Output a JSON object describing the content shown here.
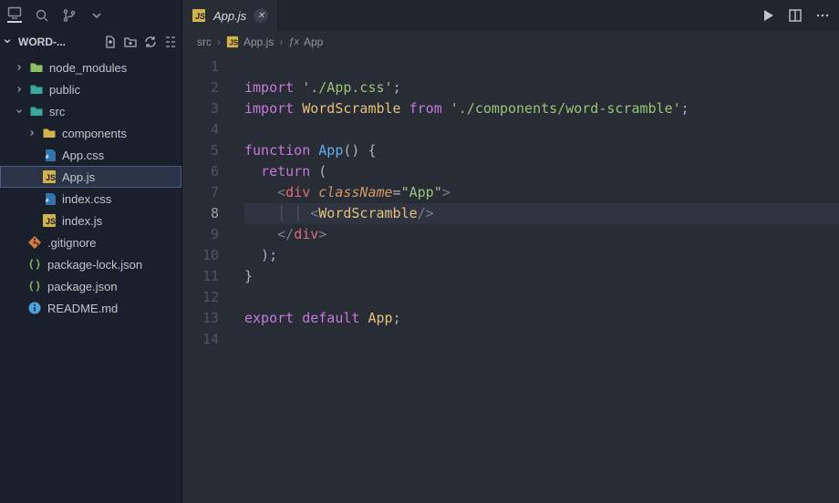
{
  "sidebar": {
    "section_label": "WORD-...",
    "items": [
      {
        "name": "node_modules",
        "type": "folder",
        "depth": 0,
        "expanded": false,
        "iconclass": "folder-green"
      },
      {
        "name": "public",
        "type": "folder",
        "depth": 0,
        "expanded": false,
        "iconclass": "folder-teal"
      },
      {
        "name": "src",
        "type": "folder",
        "depth": 0,
        "expanded": true,
        "iconclass": "folder-teal"
      },
      {
        "name": "components",
        "type": "folder",
        "depth": 1,
        "expanded": false,
        "iconclass": "folder-yellow"
      },
      {
        "name": "App.css",
        "type": "file",
        "depth": 1,
        "iconclass": "file-css"
      },
      {
        "name": "App.js",
        "type": "file",
        "depth": 1,
        "iconclass": "file-js",
        "selected": true
      },
      {
        "name": "index.css",
        "type": "file",
        "depth": 1,
        "iconclass": "file-css"
      },
      {
        "name": "index.js",
        "type": "file",
        "depth": 1,
        "iconclass": "file-js"
      },
      {
        "name": ".gitignore",
        "type": "file",
        "depth": 0,
        "iconclass": "file-git"
      },
      {
        "name": "package-lock.json",
        "type": "file",
        "depth": 0,
        "iconclass": "file-json"
      },
      {
        "name": "package.json",
        "type": "file",
        "depth": 0,
        "iconclass": "file-json"
      },
      {
        "name": "README.md",
        "type": "file",
        "depth": 0,
        "iconclass": "file-info"
      }
    ]
  },
  "tab": {
    "label": "App.js",
    "iconclass": "file-js"
  },
  "breadcrumb": {
    "parts": [
      "src",
      "App.js",
      "App"
    ]
  },
  "code": {
    "lines": 14,
    "highlighted_line": 8,
    "tokens": [
      [],
      [
        [
          "kw",
          "import"
        ],
        [
          "pn",
          " "
        ],
        [
          "str",
          "'./App.css'"
        ],
        [
          "pn",
          ";"
        ]
      ],
      [
        [
          "kw",
          "import"
        ],
        [
          "pn",
          " "
        ],
        [
          "cls",
          "WordScramble"
        ],
        [
          "pn",
          " "
        ],
        [
          "kw",
          "from"
        ],
        [
          "pn",
          " "
        ],
        [
          "str",
          "'./components/word-scramble'"
        ],
        [
          "pn",
          ";"
        ]
      ],
      [],
      [
        [
          "kw",
          "function"
        ],
        [
          "pn",
          " "
        ],
        [
          "fn",
          "App"
        ],
        [
          "pn",
          "() {"
        ]
      ],
      [
        [
          "pn",
          "  "
        ],
        [
          "kw",
          "return"
        ],
        [
          "pn",
          " ("
        ]
      ],
      [
        [
          "pn",
          "    "
        ],
        [
          "ang",
          "<"
        ],
        [
          "tag",
          "div"
        ],
        [
          "pn",
          " "
        ],
        [
          "at",
          "className"
        ],
        [
          "pn",
          "="
        ],
        [
          "str",
          "\"App\""
        ],
        [
          "ang",
          ">"
        ]
      ],
      [
        [
          "ig",
          "    "
        ],
        [
          "ig",
          "│ "
        ],
        [
          "ig",
          "│ "
        ],
        [
          "ang",
          "<"
        ],
        [
          "comp",
          "WordScramble"
        ],
        [
          "ang",
          "/>"
        ]
      ],
      [
        [
          "pn",
          "    "
        ],
        [
          "ang",
          "</"
        ],
        [
          "tag",
          "div"
        ],
        [
          "ang",
          ">"
        ]
      ],
      [
        [
          "pn",
          "  );"
        ]
      ],
      [
        [
          "pn",
          "}"
        ]
      ],
      [],
      [
        [
          "kw",
          "export"
        ],
        [
          "pn",
          " "
        ],
        [
          "kw",
          "default"
        ],
        [
          "pn",
          " "
        ],
        [
          "cls",
          "App"
        ],
        [
          "pn",
          ";"
        ]
      ],
      []
    ]
  }
}
